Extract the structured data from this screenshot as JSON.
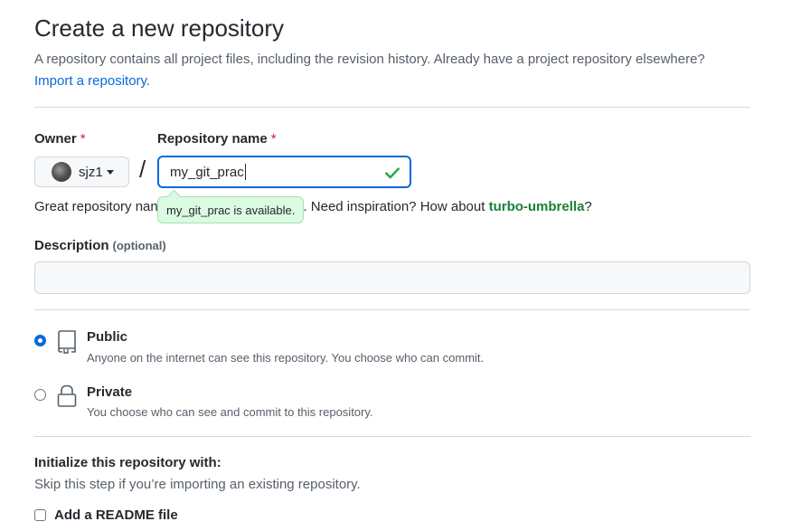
{
  "header": {
    "title": "Create a new repository",
    "lead": "A repository contains all project files, including the revision history. Already have a project repository elsewhere?",
    "import_link": "Import a repository."
  },
  "owner": {
    "label": "Owner",
    "required_mark": "*",
    "username": "sjz1"
  },
  "repo_name": {
    "label": "Repository name",
    "required_mark": "*",
    "value": "my_git_prac",
    "tooltip": "my_git_prac is available."
  },
  "hint": {
    "prefix": "Great repository nan",
    "middle": "orable. Need inspiration? How about ",
    "suggestion": "turbo-umbrella",
    "suffix": "?"
  },
  "description": {
    "label": "Description",
    "optional": "(optional)",
    "value": ""
  },
  "visibility": {
    "public": {
      "title": "Public",
      "desc": "Anyone on the internet can see this repository. You choose who can commit.",
      "selected": true
    },
    "private": {
      "title": "Private",
      "desc": "You choose who can see and commit to this repository.",
      "selected": false
    }
  },
  "init": {
    "title": "Initialize this repository with:",
    "subtitle": "Skip this step if you’re importing an existing repository.",
    "readme_label": "Add a README file"
  },
  "colors": {
    "accent": "#0969da",
    "success": "#1a7f37",
    "required": "#cf222e"
  }
}
